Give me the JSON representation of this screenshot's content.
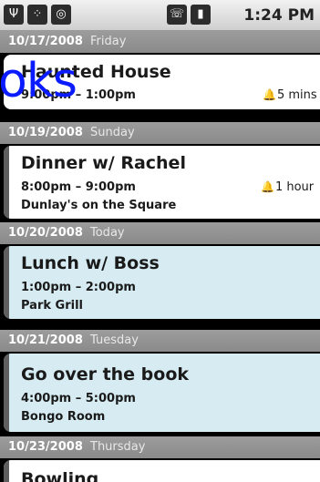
{
  "status_bar": {
    "icons": [
      "usb-icon",
      "app-icon",
      "voicemail-icon"
    ],
    "right_icons": [
      "phone-icon",
      "battery-icon"
    ],
    "time": "1:24 PM"
  },
  "overlay_text": "oks",
  "days": [
    {
      "date": "10/17/2008",
      "day": "Friday",
      "event": {
        "title": "Haunted House",
        "time": "9:00pm – 1:00pm",
        "reminder": "5 mins",
        "location": ""
      }
    },
    {
      "date": "10/19/2008",
      "day": "Sunday",
      "event": {
        "title": "Dinner w/ Rachel",
        "time": "8:00pm – 9:00pm",
        "reminder": "1 hour",
        "location": "Dunlay's on the Square"
      }
    },
    {
      "date": "10/20/2008",
      "day": "Today",
      "event": {
        "title": "Lunch w/ Boss",
        "time": "1:00pm – 2:00pm",
        "reminder": "",
        "location": "Park Grill"
      }
    },
    {
      "date": "10/21/2008",
      "day": "Tuesday",
      "event": {
        "title": "Go over the book",
        "time": "4:00pm – 5:00pm",
        "reminder": "",
        "location": "Bongo Room"
      }
    },
    {
      "date": "10/23/2008",
      "day": "Thursday",
      "event": {
        "title": "Bowling",
        "time": "",
        "reminder": "",
        "location": ""
      }
    }
  ],
  "colors": {
    "header_bg": "#939393",
    "card_white": "#ffffff",
    "card_blue": "#d6ecf2",
    "overlay_text": "#0a1cff"
  }
}
